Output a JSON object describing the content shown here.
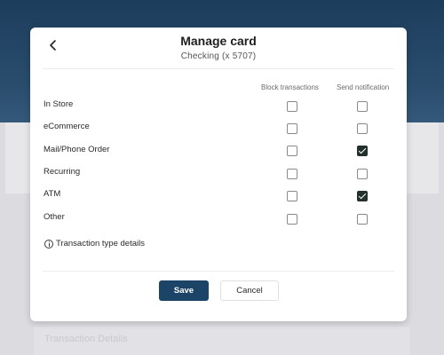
{
  "background": {
    "faded_text": "Transaction Details"
  },
  "modal": {
    "title": "Manage card",
    "subtitle": "Checking (x 5707)",
    "columns": {
      "block": "Block transactions",
      "notify": "Send notification"
    },
    "rows": [
      {
        "label": "In Store",
        "block": false,
        "notify": false
      },
      {
        "label": "eCommerce",
        "block": false,
        "notify": false
      },
      {
        "label": "Mail/Phone Order",
        "block": false,
        "notify": true
      },
      {
        "label": "Recurring",
        "block": false,
        "notify": false
      },
      {
        "label": "ATM",
        "block": false,
        "notify": true
      },
      {
        "label": "Other",
        "block": false,
        "notify": false
      }
    ],
    "details_link": "Transaction type details",
    "save_label": "Save",
    "cancel_label": "Cancel"
  },
  "colors": {
    "header_bg": "#1d3d5c",
    "primary_button": "#1c4466",
    "checked": "#23302c"
  }
}
